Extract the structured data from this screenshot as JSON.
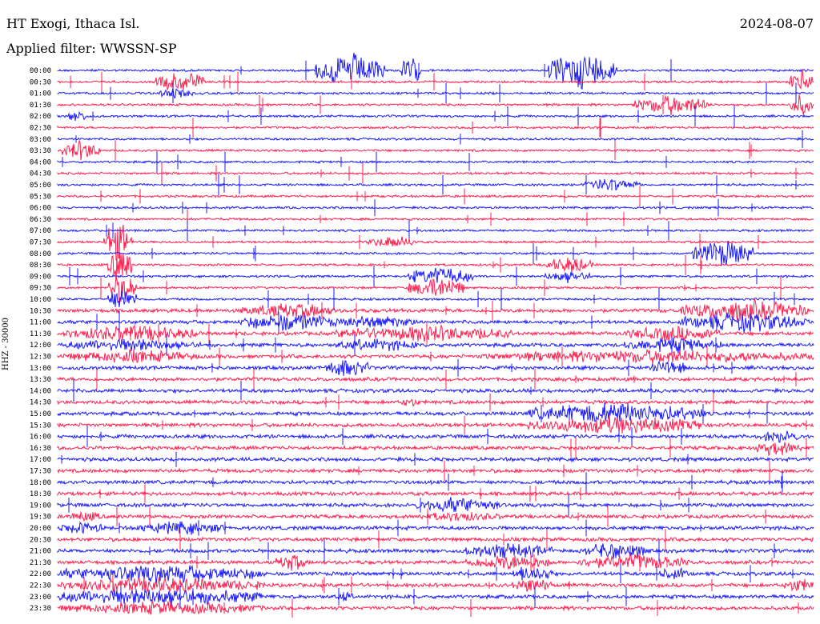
{
  "header": {
    "station": "HT Exogi, Ithaca Isl.",
    "date": "2024-08-07",
    "filter": "Applied filter: WWSSN-SP",
    "channel": "HHZ - 30000"
  },
  "colors": {
    "even_rows": "#1a1aff",
    "odd_rows": "#ff1f4e"
  },
  "chart_data": {
    "type": "line",
    "title": "",
    "y_tick_labels": [
      "00:00",
      "00:30",
      "01:00",
      "01:30",
      "02:00",
      "02:30",
      "03:00",
      "03:30",
      "04:00",
      "04:30",
      "05:00",
      "05:30",
      "06:00",
      "06:30",
      "07:00",
      "07:30",
      "08:00",
      "08:30",
      "09:00",
      "09:30",
      "10:00",
      "10:30",
      "11:00",
      "11:30",
      "12:00",
      "12:30",
      "13:00",
      "13:30",
      "14:00",
      "14:30",
      "15:00",
      "15:30",
      "16:00",
      "16:30",
      "17:00",
      "17:30",
      "18:00",
      "18:30",
      "19:00",
      "19:30",
      "20:00",
      "20:30",
      "21:00",
      "21:30",
      "22:00",
      "22:30",
      "23:00",
      "23:30"
    ],
    "trace_interval_minutes": 30,
    "trace_colors_alternate": [
      "blue",
      "red"
    ],
    "grid": false,
    "legend": "none"
  }
}
